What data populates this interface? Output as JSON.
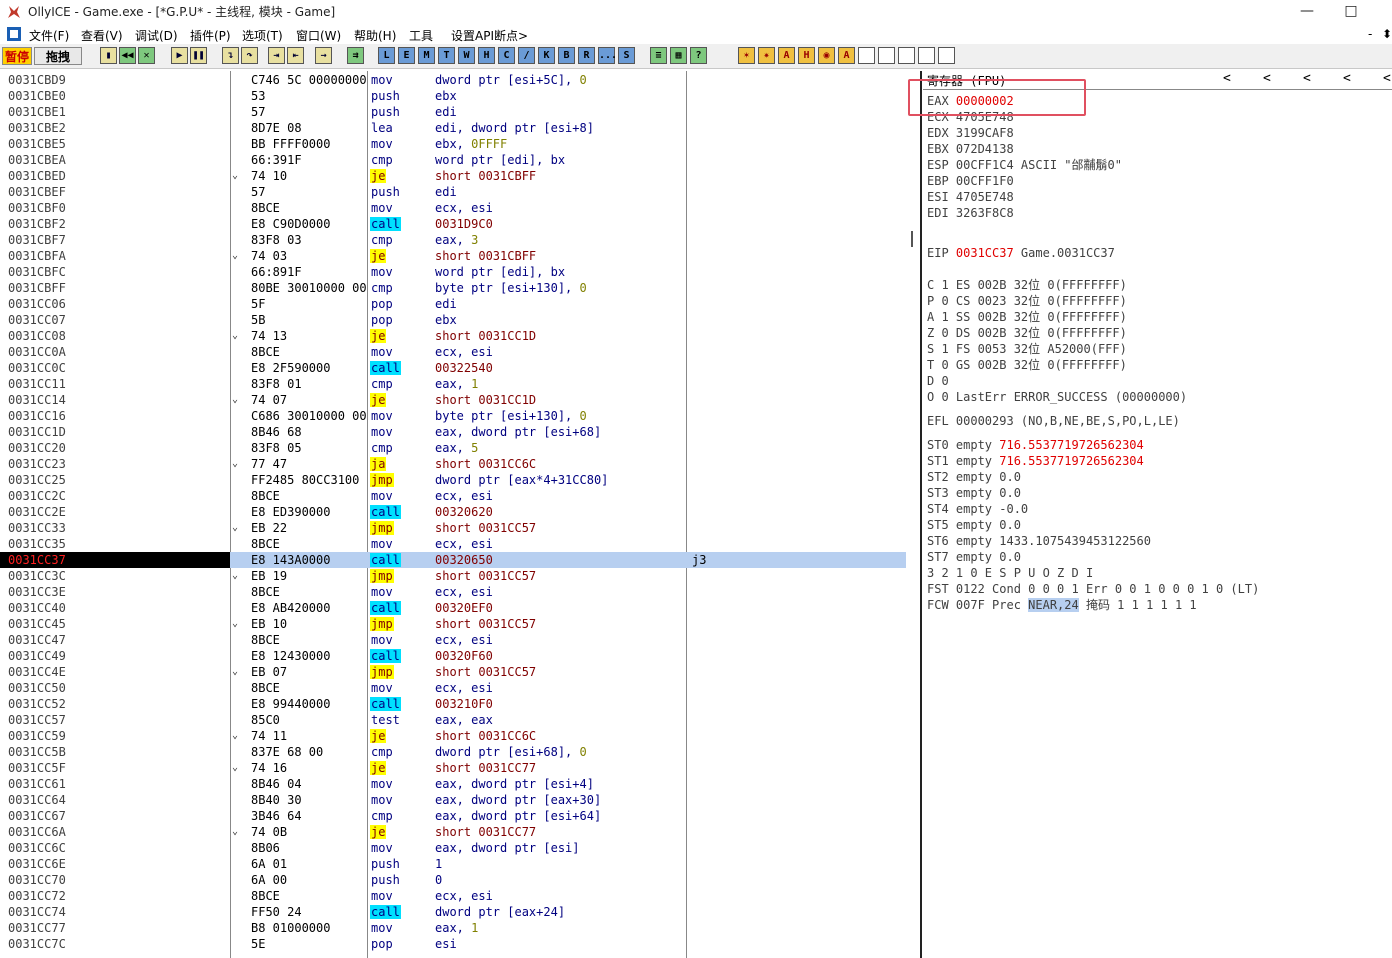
{
  "window": {
    "title": "OllyICE - Game.exe - [*G.P.U* - 主线程, 模块 - Game]",
    "min_glyph": "—",
    "max_glyph": "□"
  },
  "menu": [
    "文件(F)",
    "查看(V)",
    "调试(D)",
    "插件(P)",
    "选项(T)",
    "窗口(W)",
    "帮助(H)",
    "工具",
    "设置API断点>"
  ],
  "menu_right": [
    "-",
    "⬍"
  ],
  "toolbar": {
    "pause_label": "暂停",
    "drag_label": "拖拽",
    "letters": [
      "L",
      "E",
      "M",
      "T",
      "W",
      "H",
      "C",
      "/",
      "K",
      "B",
      "R",
      "...",
      "S"
    ]
  },
  "disasm": {
    "rows": [
      {
        "addr": "0031CBD9",
        "bytes": "C746 5C 00000000",
        "mn": "mov",
        "op": "dword ptr [esi+5C], 0"
      },
      {
        "addr": "0031CBE0",
        "bytes": "53",
        "mn": "push",
        "op": "ebx"
      },
      {
        "addr": "0031CBE1",
        "bytes": "57",
        "mn": "push",
        "op": "edi"
      },
      {
        "addr": "0031CBE2",
        "bytes": "8D7E 08",
        "mn": "lea",
        "op": "edi, dword ptr [esi+8]"
      },
      {
        "addr": "0031CBE5",
        "bytes": "BB FFFF0000",
        "mn": "mov",
        "op": "ebx, 0FFFF"
      },
      {
        "addr": "0031CBEA",
        "bytes": "66:391F",
        "mn": "cmp",
        "op": "word ptr [edi], bx"
      },
      {
        "addr": "0031CBED",
        "bytes": "74 10",
        "mn": "je",
        "op": "short 0031CBFF",
        "arrow": "⌄"
      },
      {
        "addr": "0031CBEF",
        "bytes": "57",
        "mn": "push",
        "op": "edi"
      },
      {
        "addr": "0031CBF0",
        "bytes": "8BCE",
        "mn": "mov",
        "op": "ecx, esi"
      },
      {
        "addr": "0031CBF2",
        "bytes": "E8 C90D0000",
        "mn": "call",
        "op": "0031D9C0"
      },
      {
        "addr": "0031CBF7",
        "bytes": "83F8 03",
        "mn": "cmp",
        "op": "eax, 3"
      },
      {
        "addr": "0031CBFA",
        "bytes": "74 03",
        "mn": "je",
        "op": "short 0031CBFF",
        "arrow": "⌄"
      },
      {
        "addr": "0031CBFC",
        "bytes": "66:891F",
        "mn": "mov",
        "op": "word ptr [edi], bx"
      },
      {
        "addr": "0031CBFF",
        "bytes": "80BE 30010000 00",
        "mn": "cmp",
        "op": "byte ptr [esi+130], 0"
      },
      {
        "addr": "0031CC06",
        "bytes": "5F",
        "mn": "pop",
        "op": "edi"
      },
      {
        "addr": "0031CC07",
        "bytes": "5B",
        "mn": "pop",
        "op": "ebx"
      },
      {
        "addr": "0031CC08",
        "bytes": "74 13",
        "mn": "je",
        "op": "short 0031CC1D",
        "arrow": "⌄"
      },
      {
        "addr": "0031CC0A",
        "bytes": "8BCE",
        "mn": "mov",
        "op": "ecx, esi"
      },
      {
        "addr": "0031CC0C",
        "bytes": "E8 2F590000",
        "mn": "call",
        "op": "00322540"
      },
      {
        "addr": "0031CC11",
        "bytes": "83F8 01",
        "mn": "cmp",
        "op": "eax, 1"
      },
      {
        "addr": "0031CC14",
        "bytes": "74 07",
        "mn": "je",
        "op": "short 0031CC1D",
        "arrow": "⌄"
      },
      {
        "addr": "0031CC16",
        "bytes": "C686 30010000 00",
        "mn": "mov",
        "op": "byte ptr [esi+130], 0"
      },
      {
        "addr": "0031CC1D",
        "bytes": "8B46 68",
        "mn": "mov",
        "op": "eax, dword ptr [esi+68]"
      },
      {
        "addr": "0031CC20",
        "bytes": "83F8 05",
        "mn": "cmp",
        "op": "eax, 5"
      },
      {
        "addr": "0031CC23",
        "bytes": "77 47",
        "mn": "ja",
        "op": "short 0031CC6C",
        "arrow": "⌄"
      },
      {
        "addr": "0031CC25",
        "bytes": "FF2485 80CC3100",
        "mn": "jmp",
        "op": "dword ptr [eax*4+31CC80]"
      },
      {
        "addr": "0031CC2C",
        "bytes": "8BCE",
        "mn": "mov",
        "op": "ecx, esi"
      },
      {
        "addr": "0031CC2E",
        "bytes": "E8 ED390000",
        "mn": "call",
        "op": "00320620"
      },
      {
        "addr": "0031CC33",
        "bytes": "EB 22",
        "mn": "jmp",
        "op": "short 0031CC57",
        "arrow": "⌄"
      },
      {
        "addr": "0031CC35",
        "bytes": "8BCE",
        "mn": "mov",
        "op": "ecx, esi"
      },
      {
        "addr": "0031CC37",
        "bytes": "E8 143A0000",
        "mn": "call",
        "op": "00320650",
        "comment": "j3",
        "selected": true
      },
      {
        "addr": "0031CC3C",
        "bytes": "EB 19",
        "mn": "jmp",
        "op": "short 0031CC57",
        "arrow": "⌄"
      },
      {
        "addr": "0031CC3E",
        "bytes": "8BCE",
        "mn": "mov",
        "op": "ecx, esi"
      },
      {
        "addr": "0031CC40",
        "bytes": "E8 AB420000",
        "mn": "call",
        "op": "00320EF0"
      },
      {
        "addr": "0031CC45",
        "bytes": "EB 10",
        "mn": "jmp",
        "op": "short 0031CC57",
        "arrow": "⌄"
      },
      {
        "addr": "0031CC47",
        "bytes": "8BCE",
        "mn": "mov",
        "op": "ecx, esi"
      },
      {
        "addr": "0031CC49",
        "bytes": "E8 12430000",
        "mn": "call",
        "op": "00320F60"
      },
      {
        "addr": "0031CC4E",
        "bytes": "EB 07",
        "mn": "jmp",
        "op": "short 0031CC57",
        "arrow": "⌄"
      },
      {
        "addr": "0031CC50",
        "bytes": "8BCE",
        "mn": "mov",
        "op": "ecx, esi"
      },
      {
        "addr": "0031CC52",
        "bytes": "E8 99440000",
        "mn": "call",
        "op": "003210F0"
      },
      {
        "addr": "0031CC57",
        "bytes": "85C0",
        "mn": "test",
        "op": "eax, eax"
      },
      {
        "addr": "0031CC59",
        "bytes": "74 11",
        "mn": "je",
        "op": "short 0031CC6C",
        "arrow": "⌄"
      },
      {
        "addr": "0031CC5B",
        "bytes": "837E 68 00",
        "mn": "cmp",
        "op": "dword ptr [esi+68], 0"
      },
      {
        "addr": "0031CC5F",
        "bytes": "74 16",
        "mn": "je",
        "op": "short 0031CC77",
        "arrow": "⌄"
      },
      {
        "addr": "0031CC61",
        "bytes": "8B46 04",
        "mn": "mov",
        "op": "eax, dword ptr [esi+4]"
      },
      {
        "addr": "0031CC64",
        "bytes": "8B40 30",
        "mn": "mov",
        "op": "eax, dword ptr [eax+30]"
      },
      {
        "addr": "0031CC67",
        "bytes": "3B46 64",
        "mn": "cmp",
        "op": "eax, dword ptr [esi+64]"
      },
      {
        "addr": "0031CC6A",
        "bytes": "74 0B",
        "mn": "je",
        "op": "short 0031CC77",
        "arrow": "⌄"
      },
      {
        "addr": "0031CC6C",
        "bytes": "8B06",
        "mn": "mov",
        "op": "eax, dword ptr [esi]"
      },
      {
        "addr": "0031CC6E",
        "bytes": "6A 01",
        "mn": "push",
        "op": "1"
      },
      {
        "addr": "0031CC70",
        "bytes": "6A 00",
        "mn": "push",
        "op": "0"
      },
      {
        "addr": "0031CC72",
        "bytes": "8BCE",
        "mn": "mov",
        "op": "ecx, esi"
      },
      {
        "addr": "0031CC74",
        "bytes": "FF50 24",
        "mn": "call",
        "op": "dword ptr [eax+24]"
      },
      {
        "addr": "0031CC77",
        "bytes": "B8 01000000",
        "mn": "mov",
        "op": "eax, 1"
      },
      {
        "addr": "0031CC7C",
        "bytes": "5E",
        "mn": "pop",
        "op": "esi"
      }
    ]
  },
  "registers": {
    "header": "寄存器 (FPU)",
    "chevrons": [
      "<",
      "<",
      "<",
      "<",
      "<"
    ],
    "lines": [
      {
        "t": "EAX ",
        "v": "00000002",
        "red": true,
        "y": 0
      },
      {
        "t": "ECX 4705E748",
        "y": 1
      },
      {
        "t": "EDX 3199CAF8",
        "y": 2
      },
      {
        "t": "EBX 072D4138",
        "y": 3
      },
      {
        "t": "ESP 00CFF1C4 ASCII \"邰黼鬅0\"",
        "y": 4
      },
      {
        "t": "EBP 00CFF1F0",
        "y": 5
      },
      {
        "t": "ESI 4705E748",
        "y": 6
      },
      {
        "t": "EDI 3263F8C8",
        "y": 7
      },
      {
        "t": "EIP ",
        "v": "0031CC37",
        "red": true,
        "rest": " Game.0031CC37",
        "y": 9.5
      },
      {
        "t": "C 1  ES 002B 32位 0(FFFFFFFF)",
        "y": 11.5
      },
      {
        "t": "P 0  CS 0023 32位 0(FFFFFFFF)",
        "y": 12.5
      },
      {
        "t": "A 1  SS 002B 32位 0(FFFFFFFF)",
        "y": 13.5
      },
      {
        "t": "Z 0  DS 002B 32位 0(FFFFFFFF)",
        "y": 14.5
      },
      {
        "t": "S 1  FS 0053 32位 A52000(FFF)",
        "y": 15.5
      },
      {
        "t": "T 0  GS 002B 32位 0(FFFFFFFF)",
        "y": 16.5
      },
      {
        "t": "D 0",
        "y": 17.5
      },
      {
        "t": "O 0  LastErr ERROR_SUCCESS (00000000)",
        "y": 18.5
      },
      {
        "t": "EFL 00000293 (NO,B,NE,BE,S,PO,L,LE)",
        "y": 20
      },
      {
        "t": "ST0 empty ",
        "v": "716.5537719726562304",
        "red": true,
        "y": 21.5
      },
      {
        "t": "ST1 empty ",
        "v": "716.5537719726562304",
        "red": true,
        "y": 22.5
      },
      {
        "t": "ST2 empty 0.0",
        "y": 23.5
      },
      {
        "t": "ST3 empty 0.0",
        "y": 24.5
      },
      {
        "t": "ST4 empty -0.0",
        "y": 25.5
      },
      {
        "t": "ST5 empty 0.0",
        "y": 26.5
      },
      {
        "t": "ST6 empty 1433.1075439453122560",
        "y": 27.5
      },
      {
        "t": "ST7 empty 0.0",
        "y": 28.5
      },
      {
        "t": "               3 2 1 0      E S P U O Z D I",
        "y": 29.5
      },
      {
        "t": "FST 0122  Cond 0 0 0 1  Err 0 0 1 0 0 0 1 0  (LT)",
        "y": 30.5
      },
      {
        "t": "FCW 007F  Prec ",
        "v": "NEAR,24",
        "sel": true,
        "rest": "  掩码    1 1 1 1 1 1",
        "y": 31.5
      }
    ]
  }
}
